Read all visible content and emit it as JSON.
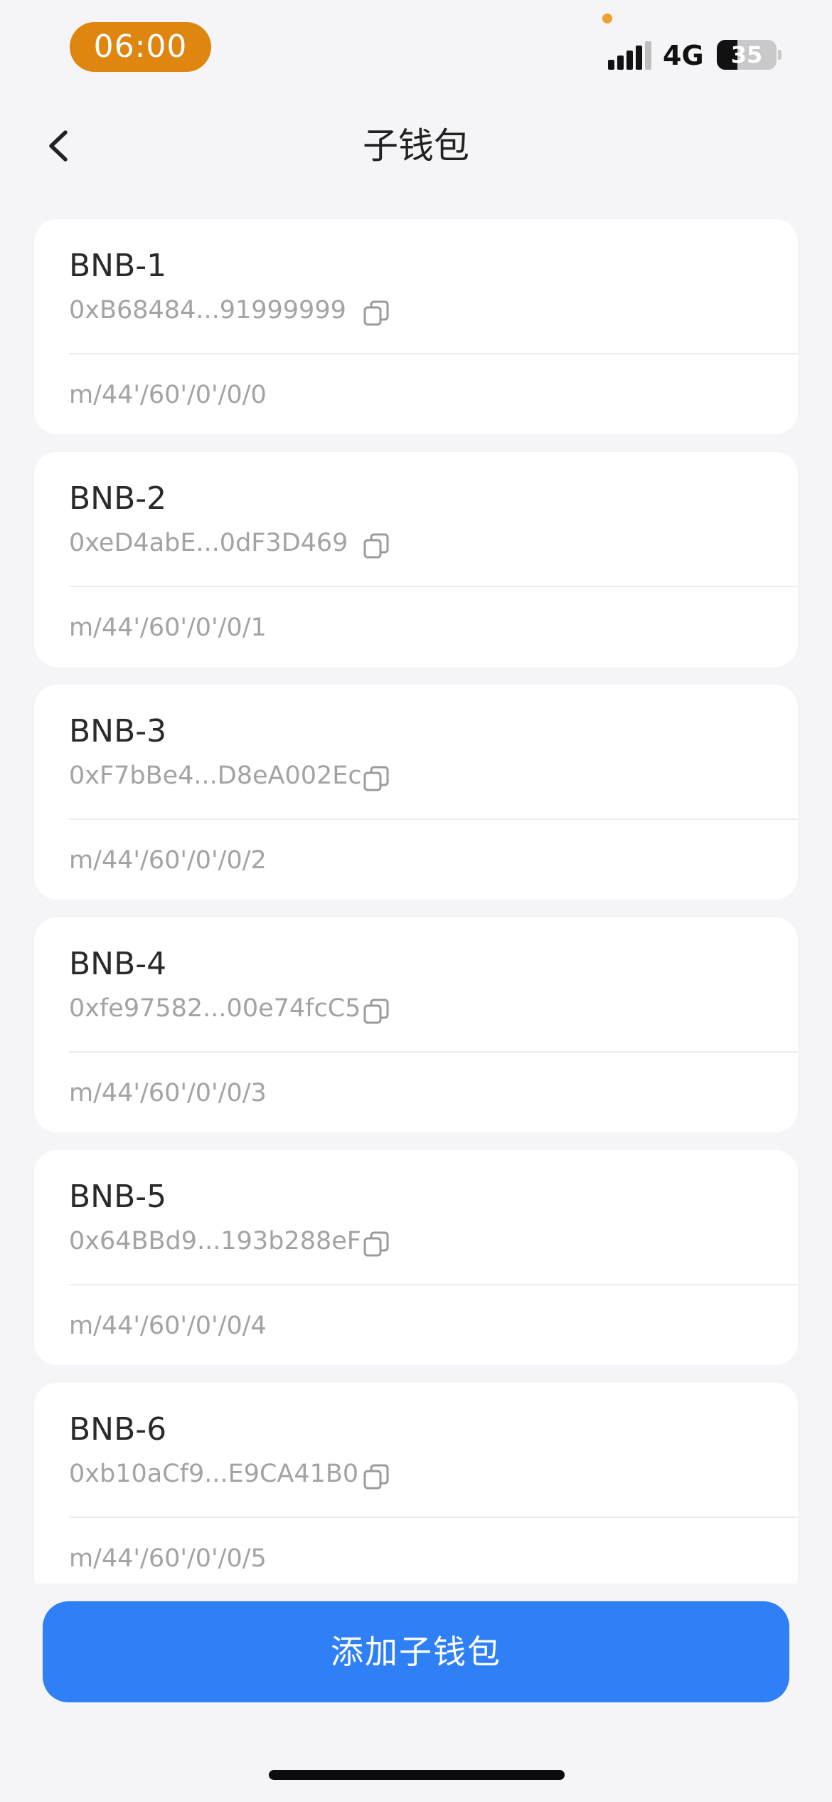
{
  "status_bar": {
    "time": "06:00",
    "network": "4G",
    "battery": "35",
    "battery_level_percent": 35,
    "time_pill_color": "#de8610"
  },
  "header": {
    "title": "子钱包",
    "back_icon": "chevron-left-icon"
  },
  "wallets": [
    {
      "name": "BNB-1",
      "address": "0xB68484...91999999",
      "path": "m/44'/60'/0'/0/0"
    },
    {
      "name": "BNB-2",
      "address": "0xeD4abE...0dF3D469",
      "path": "m/44'/60'/0'/0/1"
    },
    {
      "name": "BNB-3",
      "address": "0xF7bBe4...D8eA002Ec",
      "path": "m/44'/60'/0'/0/2"
    },
    {
      "name": "BNB-4",
      "address": "0xfe97582...00e74fcC5",
      "path": "m/44'/60'/0'/0/3"
    },
    {
      "name": "BNB-5",
      "address": "0x64BBd9...193b288eF",
      "path": "m/44'/60'/0'/0/4"
    },
    {
      "name": "BNB-6",
      "address": "0xb10aCf9...E9CA41B0",
      "path": "m/44'/60'/0'/0/5"
    }
  ],
  "copy_icon": "copy-icon",
  "footer": {
    "add_button_label": "添加子钱包",
    "button_color": "#2f80f6"
  }
}
